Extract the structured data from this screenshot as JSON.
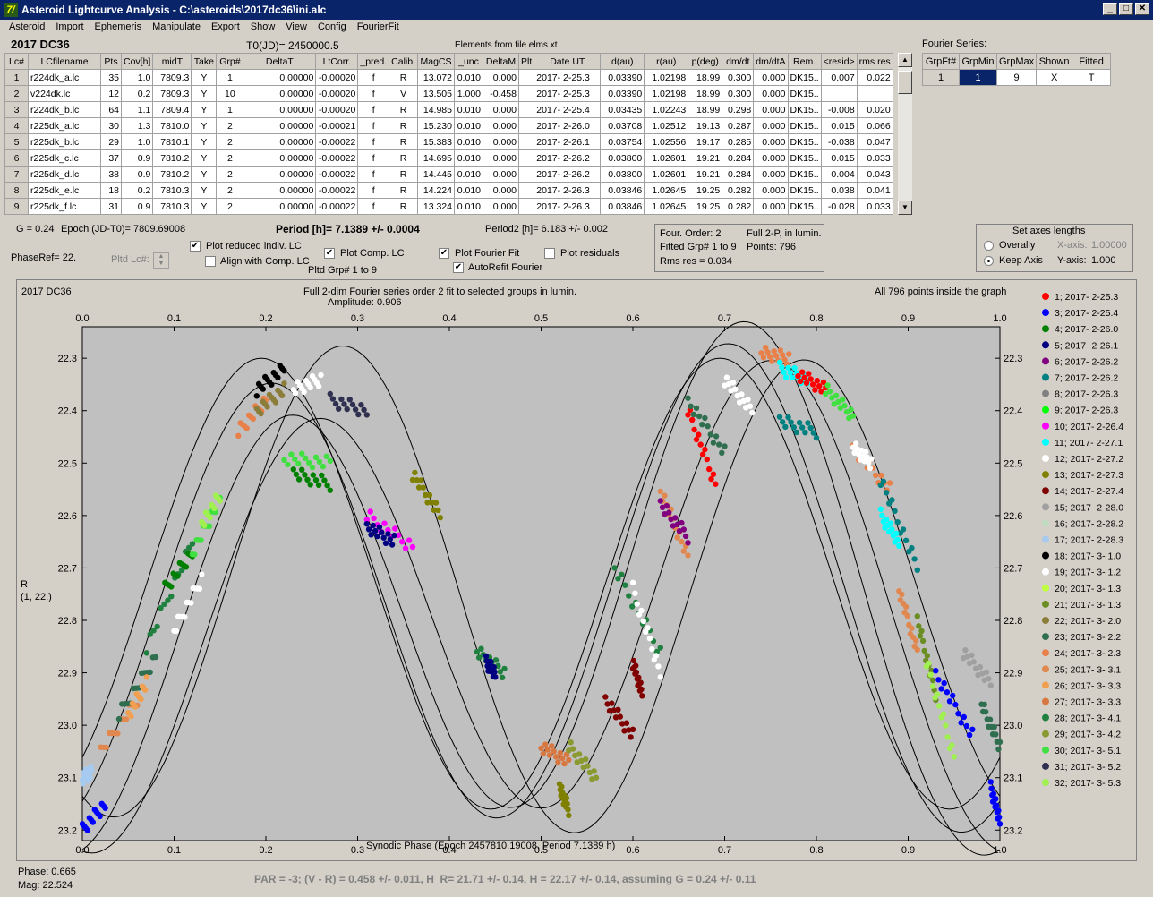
{
  "window": {
    "title": "Asteroid Lightcurve Analysis - C:\\asteroids\\2017dc36\\ini.alc",
    "app_icon": "7/"
  },
  "menu": [
    "Asteroid",
    "Import",
    "Ephemeris",
    "Manipulate",
    "Export",
    "Show",
    "View",
    "Config",
    "FourierFit"
  ],
  "header": {
    "object": "2017 DC36",
    "t0": "T0(JD)= 2450000.5",
    "elements": "Elements from file elms.xt"
  },
  "table": {
    "columns": [
      "Lc#",
      "LCfilename",
      "Pts",
      "Cov[h]",
      "midT",
      "Take",
      "Grp#",
      "DeltaT",
      "LtCorr.",
      "_pred.",
      "Calib.",
      "MagCS",
      "_unc",
      "DeltaM",
      "Plt",
      "Date UT",
      "d(au)",
      "r(au)",
      "p(deg)",
      "dm/dt",
      "dm/dtA",
      "Rem.",
      "<resid>",
      "rms res"
    ],
    "rows": [
      [
        "1",
        "r224dk_a.lc",
        "35",
        "1.0",
        "7809.3",
        "Y",
        "1",
        "0.00000",
        "-0.00020",
        "f",
        "R",
        "13.072",
        "0.010",
        "0.000",
        "",
        "2017- 2-25.3",
        "0.03390",
        "1.02198",
        "18.99",
        "0.300",
        "0.000",
        "DK15..",
        "0.007",
        "0.022"
      ],
      [
        "2",
        "v224dk.lc",
        "12",
        "0.2",
        "7809.3",
        "Y",
        "10",
        "0.00000",
        "-0.00020",
        "f",
        "V",
        "13.505",
        "1.000",
        "-0.458",
        "",
        "2017- 2-25.3",
        "0.03390",
        "1.02198",
        "18.99",
        "0.300",
        "0.000",
        "DK15..",
        "",
        ""
      ],
      [
        "3",
        "r224dk_b.lc",
        "64",
        "1.1",
        "7809.4",
        "Y",
        "1",
        "0.00000",
        "-0.00020",
        "f",
        "R",
        "14.985",
        "0.010",
        "0.000",
        "",
        "2017- 2-25.4",
        "0.03435",
        "1.02243",
        "18.99",
        "0.298",
        "0.000",
        "DK15..",
        "-0.008",
        "0.020"
      ],
      [
        "4",
        "r225dk_a.lc",
        "30",
        "1.3",
        "7810.0",
        "Y",
        "2",
        "0.00000",
        "-0.00021",
        "f",
        "R",
        "15.230",
        "0.010",
        "0.000",
        "",
        "2017- 2-26.0",
        "0.03708",
        "1.02512",
        "19.13",
        "0.287",
        "0.000",
        "DK15..",
        "0.015",
        "0.066"
      ],
      [
        "5",
        "r225dk_b.lc",
        "29",
        "1.0",
        "7810.1",
        "Y",
        "2",
        "0.00000",
        "-0.00022",
        "f",
        "R",
        "15.383",
        "0.010",
        "0.000",
        "",
        "2017- 2-26.1",
        "0.03754",
        "1.02556",
        "19.17",
        "0.285",
        "0.000",
        "DK15..",
        "-0.038",
        "0.047"
      ],
      [
        "6",
        "r225dk_c.lc",
        "37",
        "0.9",
        "7810.2",
        "Y",
        "2",
        "0.00000",
        "-0.00022",
        "f",
        "R",
        "14.695",
        "0.010",
        "0.000",
        "",
        "2017- 2-26.2",
        "0.03800",
        "1.02601",
        "19.21",
        "0.284",
        "0.000",
        "DK15..",
        "0.015",
        "0.033"
      ],
      [
        "7",
        "r225dk_d.lc",
        "38",
        "0.9",
        "7810.2",
        "Y",
        "2",
        "0.00000",
        "-0.00022",
        "f",
        "R",
        "14.445",
        "0.010",
        "0.000",
        "",
        "2017- 2-26.2",
        "0.03800",
        "1.02601",
        "19.21",
        "0.284",
        "0.000",
        "DK15..",
        "0.004",
        "0.043"
      ],
      [
        "8",
        "r225dk_e.lc",
        "18",
        "0.2",
        "7810.3",
        "Y",
        "2",
        "0.00000",
        "-0.00022",
        "f",
        "R",
        "14.224",
        "0.010",
        "0.000",
        "",
        "2017- 2-26.3",
        "0.03846",
        "1.02645",
        "19.25",
        "0.282",
        "0.000",
        "DK15..",
        "0.038",
        "0.041"
      ],
      [
        "9",
        "r225dk_f.lc",
        "31",
        "0.9",
        "7810.3",
        "Y",
        "2",
        "0.00000",
        "-0.00022",
        "f",
        "R",
        "13.324",
        "0.010",
        "0.000",
        "",
        "2017- 2-26.3",
        "0.03846",
        "1.02645",
        "19.25",
        "0.282",
        "0.000",
        "DK15..",
        "-0.028",
        "0.033"
      ]
    ]
  },
  "fourier_series": {
    "title": "Fourier Series:",
    "columns": [
      "GrpFt#",
      "GrpMin",
      "GrpMax",
      "Shown",
      "Fitted"
    ],
    "row": [
      "1",
      "1",
      "9",
      "X",
      "T"
    ]
  },
  "info": {
    "g": "G = 0.24",
    "epoch": "Epoch (JD-T0)= 7809.69008",
    "period": "Period [h]= 7.1389 +/- 0.0004",
    "period2": "Period2 [h]= 6.183 +/- 0.002",
    "phaseref": "PhaseRef= 22.",
    "pltd_lc": "Pltd Lc#:"
  },
  "checks": {
    "plot_reduced": "Plot reduced indiv. LC",
    "align": "Align with Comp. LC",
    "plot_comp": "Plot Comp. LC",
    "pltd_grp": "Pltd Grp#  1   to   9",
    "plot_fourier": "Plot Fourier Fit",
    "autorefit": "AutoRefit Fourier",
    "plot_residuals": "Plot residuals"
  },
  "fit_box": {
    "order": "Four. Order:  2",
    "fitted": "Fitted Grp# 1 to 9",
    "rms": "Rms res      = 0.034",
    "full2p": "Full 2-P,  in lumin.",
    "points": "Points: 796"
  },
  "axes_box": {
    "title": "Set axes lengths",
    "overall": "Overally",
    "keep": "Keep Axis",
    "x_label": "X-axis:",
    "x_val": "1.00000",
    "y_label": "Y-axis:",
    "y_val": "1.000"
  },
  "plot": {
    "object": "2017 DC36",
    "title1": "Full 2-dim Fourier series order 2 fit to selected groups in lumin.",
    "title2": "Amplitude: 0.906",
    "inside": "All 796 points inside the graph",
    "ylabel1": "R",
    "ylabel2": "(1, 22.)",
    "xlabel": "Synodic Phase (Epoch 2457810.19008, Period 7.1389 h)"
  },
  "chart_data": {
    "type": "scatter",
    "x_ticks": [
      "0.0",
      "0.1",
      "0.2",
      "0.3",
      "0.4",
      "0.5",
      "0.6",
      "0.7",
      "0.8",
      "0.9",
      "1.0"
    ],
    "y_ticks": [
      "22.3",
      "22.4",
      "22.5",
      "22.6",
      "22.7",
      "22.8",
      "22.9",
      "23.0",
      "23.1",
      "23.2"
    ],
    "xlim": [
      0,
      1
    ],
    "ylim": [
      23.22,
      22.24
    ],
    "legend": [
      {
        "label": "1; 2017- 2-25.3",
        "color": "#ff0000"
      },
      {
        "label": "3; 2017- 2-25.4",
        "color": "#0000ff"
      },
      {
        "label": "4; 2017- 2-26.0",
        "color": "#008000"
      },
      {
        "label": "5; 2017- 2-26.1",
        "color": "#000080"
      },
      {
        "label": "6; 2017- 2-26.2",
        "color": "#800080"
      },
      {
        "label": "7; 2017- 2-26.2",
        "color": "#008080"
      },
      {
        "label": "8; 2017- 2-26.3",
        "color": "#808080"
      },
      {
        "label": "9; 2017- 2-26.3",
        "color": "#00ff00"
      },
      {
        "label": "10; 2017- 2-26.4",
        "color": "#ff00ff"
      },
      {
        "label": "11; 2017- 2-27.1",
        "color": "#00ffff"
      },
      {
        "label": "12; 2017- 2-27.2",
        "color": "#ffffff"
      },
      {
        "label": "13; 2017- 2-27.3",
        "color": "#808000"
      },
      {
        "label": "14; 2017- 2-27.4",
        "color": "#800000"
      },
      {
        "label": "15; 2017- 2-28.0",
        "color": "#a0a0a0"
      },
      {
        "label": "16; 2017- 2-28.2",
        "color": "#c0dcc0"
      },
      {
        "label": "17; 2017- 2-28.3",
        "color": "#a6caf0"
      },
      {
        "label": "18; 2017- 3- 1.0",
        "color": "#000000"
      },
      {
        "label": "19; 2017- 3- 1.2",
        "color": "#ffffff"
      },
      {
        "label": "20; 2017- 3- 1.3",
        "color": "#c0ff40"
      },
      {
        "label": "21; 2017- 3- 1.3",
        "color": "#6b8e23"
      },
      {
        "label": "22; 2017- 3- 2.0",
        "color": "#8b7d3a"
      },
      {
        "label": "23; 2017- 3- 2.2",
        "color": "#2f6f4f"
      },
      {
        "label": "24; 2017- 3- 2.3",
        "color": "#e8804a"
      },
      {
        "label": "25; 2017- 3- 3.1",
        "color": "#e08850"
      },
      {
        "label": "26; 2017- 3- 3.3",
        "color": "#f0a050"
      },
      {
        "label": "27; 2017- 3- 3.3",
        "color": "#d87840"
      },
      {
        "label": "28; 2017- 3- 4.1",
        "color": "#208040"
      },
      {
        "label": "29; 2017- 3- 4.2",
        "color": "#8a9a30"
      },
      {
        "label": "30; 2017- 3- 5.1",
        "color": "#40e040"
      },
      {
        "label": "31; 2017- 3- 5.2",
        "color": "#303050"
      },
      {
        "label": "32; 2017- 3- 5.3",
        "color": "#a0f050"
      }
    ],
    "clusters": [
      {
        "color": "#0000ff",
        "x0": 0.0,
        "x1": 0.025,
        "y0": 23.2,
        "y1": 23.15
      },
      {
        "color": "#a6caf0",
        "x0": 0.0,
        "x1": 0.01,
        "y0": 23.1,
        "y1": 23.09
      },
      {
        "color": "#e08850",
        "x0": 0.02,
        "x1": 0.06,
        "y0": 23.05,
        "y1": 22.95
      },
      {
        "color": "#2f6f4f",
        "x0": 0.04,
        "x1": 0.08,
        "y0": 22.98,
        "y1": 22.87
      },
      {
        "color": "#f0a050",
        "x0": 0.05,
        "x1": 0.07,
        "y0": 22.98,
        "y1": 22.92
      },
      {
        "color": "#208040",
        "x0": 0.07,
        "x1": 0.12,
        "y0": 22.85,
        "y1": 22.65
      },
      {
        "color": "#ffffff",
        "x0": 0.1,
        "x1": 0.13,
        "y0": 22.82,
        "y1": 22.72
      },
      {
        "color": "#008000",
        "x0": 0.09,
        "x1": 0.12,
        "y0": 22.74,
        "y1": 22.67
      },
      {
        "color": "#40e040",
        "x0": 0.12,
        "x1": 0.15,
        "y0": 22.67,
        "y1": 22.57
      },
      {
        "color": "#a0f050",
        "x0": 0.13,
        "x1": 0.15,
        "y0": 22.62,
        "y1": 22.56
      },
      {
        "color": "#e8804a",
        "x0": 0.17,
        "x1": 0.2,
        "y0": 22.44,
        "y1": 22.38
      },
      {
        "color": "#8b7d3a",
        "x0": 0.19,
        "x1": 0.22,
        "y0": 22.4,
        "y1": 22.36
      },
      {
        "color": "#000000",
        "x0": 0.19,
        "x1": 0.22,
        "y0": 22.36,
        "y1": 22.32
      },
      {
        "color": "#ffffff",
        "x0": 0.23,
        "x1": 0.26,
        "y0": 22.36,
        "y1": 22.34
      },
      {
        "color": "#303050",
        "x0": 0.27,
        "x1": 0.31,
        "y0": 22.38,
        "y1": 22.4
      },
      {
        "color": "#40e040",
        "x0": 0.22,
        "x1": 0.27,
        "y0": 22.49,
        "y1": 22.5
      },
      {
        "color": "#008000",
        "x0": 0.23,
        "x1": 0.27,
        "y0": 22.52,
        "y1": 22.54
      },
      {
        "color": "#ff00ff",
        "x0": 0.31,
        "x1": 0.36,
        "y0": 22.6,
        "y1": 22.66
      },
      {
        "color": "#000080",
        "x0": 0.31,
        "x1": 0.34,
        "y0": 22.62,
        "y1": 22.65
      },
      {
        "color": "#808000",
        "x0": 0.36,
        "x1": 0.39,
        "y0": 22.52,
        "y1": 22.6
      },
      {
        "color": "#208040",
        "x0": 0.43,
        "x1": 0.46,
        "y0": 22.86,
        "y1": 22.9
      },
      {
        "color": "#000080",
        "x0": 0.44,
        "x1": 0.45,
        "y0": 22.88,
        "y1": 22.9
      },
      {
        "color": "#d87840",
        "x0": 0.5,
        "x1": 0.53,
        "y0": 23.04,
        "y1": 23.07
      },
      {
        "color": "#808000",
        "x0": 0.52,
        "x1": 0.53,
        "y0": 23.12,
        "y1": 23.16
      },
      {
        "color": "#8a9a30",
        "x0": 0.53,
        "x1": 0.56,
        "y0": 23.04,
        "y1": 23.1
      },
      {
        "color": "#800000",
        "x0": 0.57,
        "x1": 0.6,
        "y0": 22.95,
        "y1": 23.02
      },
      {
        "color": "#800000",
        "x0": 0.6,
        "x1": 0.61,
        "y0": 22.88,
        "y1": 22.94
      },
      {
        "color": "#208040",
        "x0": 0.58,
        "x1": 0.63,
        "y0": 22.7,
        "y1": 22.86
      },
      {
        "color": "#ffffff",
        "x0": 0.6,
        "x1": 0.63,
        "y0": 22.74,
        "y1": 22.9
      },
      {
        "color": "#e08850",
        "x0": 0.63,
        "x1": 0.66,
        "y0": 22.55,
        "y1": 22.68
      },
      {
        "color": "#800080",
        "x0": 0.63,
        "x1": 0.66,
        "y0": 22.58,
        "y1": 22.64
      },
      {
        "color": "#ff0000",
        "x0": 0.66,
        "x1": 0.69,
        "y0": 22.4,
        "y1": 22.54
      },
      {
        "color": "#2f6f4f",
        "x0": 0.66,
        "x1": 0.7,
        "y0": 22.38,
        "y1": 22.48
      },
      {
        "color": "#ffffff",
        "x0": 0.7,
        "x1": 0.73,
        "y0": 22.34,
        "y1": 22.4
      },
      {
        "color": "#e8804a",
        "x0": 0.74,
        "x1": 0.77,
        "y0": 22.29,
        "y1": 22.3
      },
      {
        "color": "#00ffff",
        "x0": 0.76,
        "x1": 0.79,
        "y0": 22.32,
        "y1": 22.34
      },
      {
        "color": "#ff0000",
        "x0": 0.78,
        "x1": 0.81,
        "y0": 22.33,
        "y1": 22.36
      },
      {
        "color": "#008080",
        "x0": 0.76,
        "x1": 0.8,
        "y0": 22.42,
        "y1": 22.44
      },
      {
        "color": "#40e040",
        "x0": 0.81,
        "x1": 0.84,
        "y0": 22.36,
        "y1": 22.41
      },
      {
        "color": "#e8804a",
        "x0": 0.84,
        "x1": 0.88,
        "y0": 22.47,
        "y1": 22.55
      },
      {
        "color": "#008080",
        "x0": 0.87,
        "x1": 0.91,
        "y0": 22.53,
        "y1": 22.7
      },
      {
        "color": "#ffffff",
        "x0": 0.84,
        "x1": 0.86,
        "y0": 22.47,
        "y1": 22.5
      },
      {
        "color": "#00ffff",
        "x0": 0.87,
        "x1": 0.89,
        "y0": 22.6,
        "y1": 22.65
      },
      {
        "color": "#e08850",
        "x0": 0.89,
        "x1": 0.91,
        "y0": 22.74,
        "y1": 22.86
      },
      {
        "color": "#6b8e23",
        "x0": 0.91,
        "x1": 0.93,
        "y0": 22.8,
        "y1": 22.94
      },
      {
        "color": "#a0f050",
        "x0": 0.92,
        "x1": 0.95,
        "y0": 22.88,
        "y1": 23.06
      },
      {
        "color": "#0000ff",
        "x0": 0.93,
        "x1": 0.97,
        "y0": 22.9,
        "y1": 23.02
      },
      {
        "color": "#a0a0a0",
        "x0": 0.96,
        "x1": 0.99,
        "y0": 22.86,
        "y1": 22.92
      },
      {
        "color": "#2f6f4f",
        "x0": 0.98,
        "x1": 1.0,
        "y0": 22.96,
        "y1": 23.04
      },
      {
        "color": "#0000ff",
        "x0": 0.99,
        "x1": 1.0,
        "y0": 23.12,
        "y1": 23.18
      }
    ]
  },
  "status": {
    "phase": "Phase:  0.665",
    "mag": "Mag:    22.524",
    "par": "PAR = -3; (V - R) = 0.458 +/- 0.011, H_R= 21.71 +/- 0.14, H = 22.17 +/- 0.14, assuming G = 0.24 +/- 0.11"
  }
}
